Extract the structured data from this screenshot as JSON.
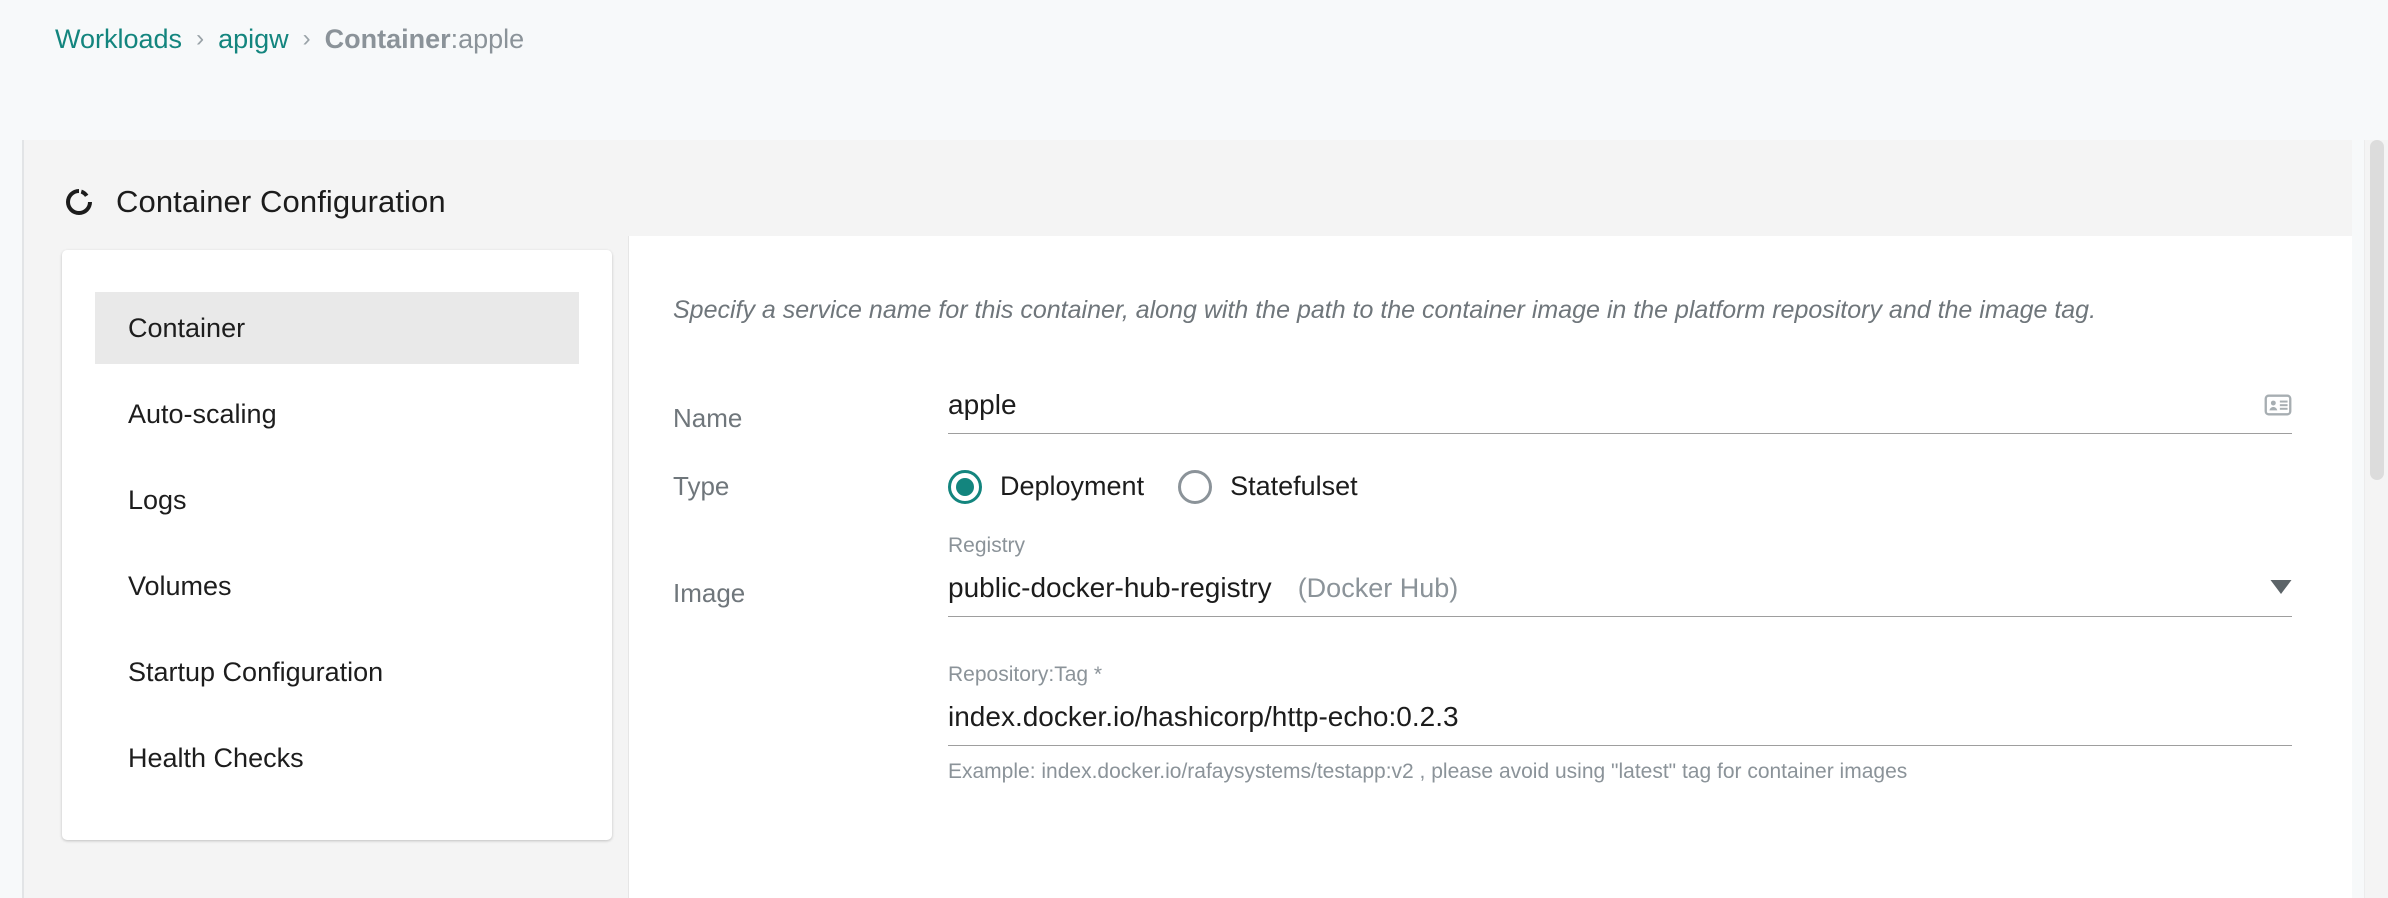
{
  "breadcrumb": {
    "items": [
      {
        "label": "Workloads",
        "type": "link"
      },
      {
        "label": "apigw",
        "type": "link"
      },
      {
        "label": "Container",
        "type": "current"
      }
    ],
    "separator": "›",
    "current_value": ":apple"
  },
  "panel": {
    "title": "Container Configuration",
    "title_icon": "ring-icon"
  },
  "sidebar": {
    "items": [
      {
        "label": "Container",
        "active": true
      },
      {
        "label": "Auto-scaling",
        "active": false
      },
      {
        "label": "Logs",
        "active": false
      },
      {
        "label": "Volumes",
        "active": false
      },
      {
        "label": "Startup Configuration",
        "active": false
      },
      {
        "label": "Health Checks",
        "active": false
      }
    ]
  },
  "form": {
    "description": "Specify a service name for this container, along with the path to the container image in the platform repository and the image tag.",
    "name": {
      "label": "Name",
      "value": "apple",
      "placeholder": "",
      "trailing_icon": "contact-card-icon"
    },
    "type": {
      "label": "Type",
      "options": [
        {
          "label": "Deployment",
          "selected": true
        },
        {
          "label": "Statefulset",
          "selected": false
        }
      ]
    },
    "image": {
      "label": "Image",
      "registry": {
        "float_label": "Registry",
        "value": "public-docker-hub-registry",
        "suffix": "(Docker Hub)",
        "dropdown_icon": "chevron-down-icon"
      },
      "repository_tag": {
        "float_label": "Repository:Tag *",
        "value": "index.docker.io/hashicorp/http-echo:0.2.3",
        "hint": "Example: index.docker.io/rafaysystems/testapp:v2 , please avoid using \"latest\" tag for container images"
      }
    }
  },
  "colors": {
    "accent_teal": "#13857e",
    "page_bg": "#f7f9fa",
    "panel_bg": "#f4f4f4",
    "card_bg": "#ffffff",
    "muted_text": "#8b9399"
  }
}
